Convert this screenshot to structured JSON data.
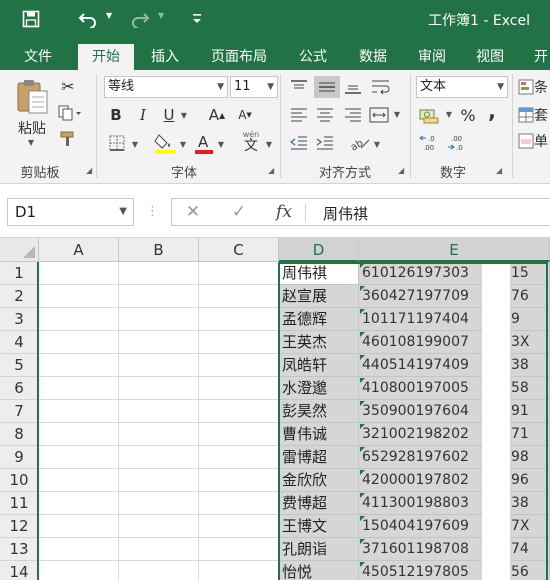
{
  "titlebar": {
    "title": "工作簿1 - Excel",
    "save_icon": "save-icon",
    "undo_icon": "undo-icon",
    "redo_icon": "redo-icon",
    "customize_icon": "customize-qat-icon"
  },
  "tabs": [
    "文件",
    "开始",
    "插入",
    "页面布局",
    "公式",
    "数据",
    "审阅",
    "视图",
    "开"
  ],
  "active_tab": "开始",
  "ribbon": {
    "clipboard": {
      "paste_label": "粘贴",
      "group_label": "剪贴板"
    },
    "font": {
      "font_name": "等线",
      "font_size": "11",
      "bold": "B",
      "italic": "I",
      "underline": "U",
      "group_label": "字体",
      "wen_label": "wén",
      "wen_char": "文",
      "increase": "A",
      "decrease": "A"
    },
    "alignment": {
      "group_label": "对齐方式"
    },
    "number": {
      "format": "文本",
      "group_label": "数字",
      "percent": "%",
      "comma": ","
    },
    "styles": {
      "items": [
        "条",
        "套",
        "单"
      ]
    },
    "colors": {
      "accent": "#217346",
      "highlight": "#ffff00",
      "font_color": "#e02020"
    }
  },
  "formula_bar": {
    "name_box": "D1",
    "cancel": "✕",
    "confirm": "✓",
    "fx": "fx",
    "content": "周伟祺"
  },
  "grid": {
    "columns": [
      "A",
      "B",
      "C",
      "D",
      "E"
    ],
    "rows": [
      {
        "num": "1",
        "name": "周伟祺",
        "id": "610126197303",
        "tail": "15"
      },
      {
        "num": "2",
        "name": "赵宣展",
        "id": "360427197709",
        "tail": "76"
      },
      {
        "num": "3",
        "name": "孟德辉",
        "id": "101171197404",
        "tail": "9"
      },
      {
        "num": "4",
        "name": "王英杰",
        "id": "460108199007",
        "tail": "3X"
      },
      {
        "num": "5",
        "name": "凤皓轩",
        "id": "440514197409",
        "tail": "38"
      },
      {
        "num": "6",
        "name": "水澄邈",
        "id": "410800197005",
        "tail": "58"
      },
      {
        "num": "7",
        "name": "彭昊然",
        "id": "350900197604",
        "tail": "91"
      },
      {
        "num": "8",
        "name": "曹伟诚",
        "id": "321002198202",
        "tail": "71"
      },
      {
        "num": "9",
        "name": "雷博超",
        "id": "652928197602",
        "tail": "98"
      },
      {
        "num": "10",
        "name": "金欣欣",
        "id": "420000197802",
        "tail": "96"
      },
      {
        "num": "11",
        "name": "费博超",
        "id": "411300198803",
        "tail": "38"
      },
      {
        "num": "12",
        "name": "王博文",
        "id": "150404197609",
        "tail": "7X"
      },
      {
        "num": "13",
        "name": "孔朗诣",
        "id": "371601198708",
        "tail": "74"
      },
      {
        "num": "14",
        "name": "怡悦",
        "id": "450512197805",
        "tail": "56"
      }
    ]
  }
}
